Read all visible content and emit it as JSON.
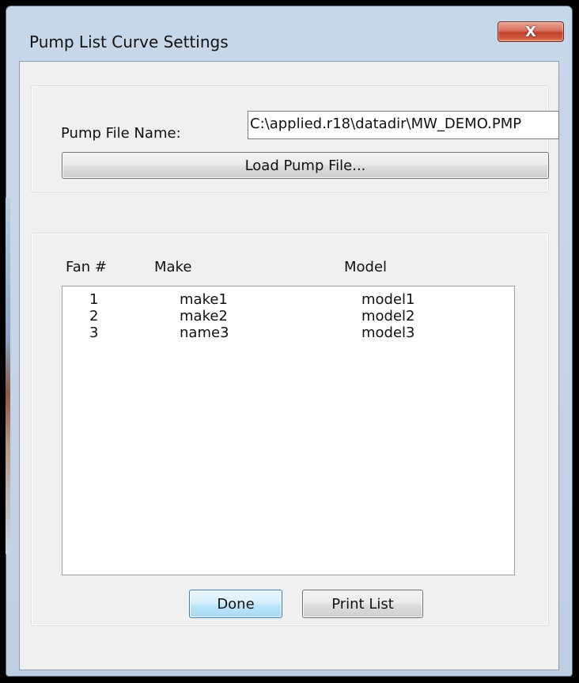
{
  "window": {
    "title": "Pump List Curve Settings",
    "close_glyph": "X",
    "close_icon": "close-icon"
  },
  "pump_file": {
    "label": "Pump File Name:",
    "value": "C:\\applied.r18\\datadir\\MW_DEMO.PMP",
    "load_button": "Load Pump File..."
  },
  "list": {
    "headers": {
      "fan": "Fan #",
      "make": "Make",
      "model": "Model"
    },
    "rows": [
      {
        "fan": "1",
        "make": "make1",
        "model": "model1"
      },
      {
        "fan": "2",
        "make": "make2",
        "model": "model2"
      },
      {
        "fan": "3",
        "make": "name3",
        "model": "model3"
      }
    ]
  },
  "buttons": {
    "done": "Done",
    "print": "Print List"
  },
  "colors": {
    "close_button": "#c7432e",
    "default_button_border": "#3c7fb1",
    "dialog_background": "#f0f0f0"
  }
}
